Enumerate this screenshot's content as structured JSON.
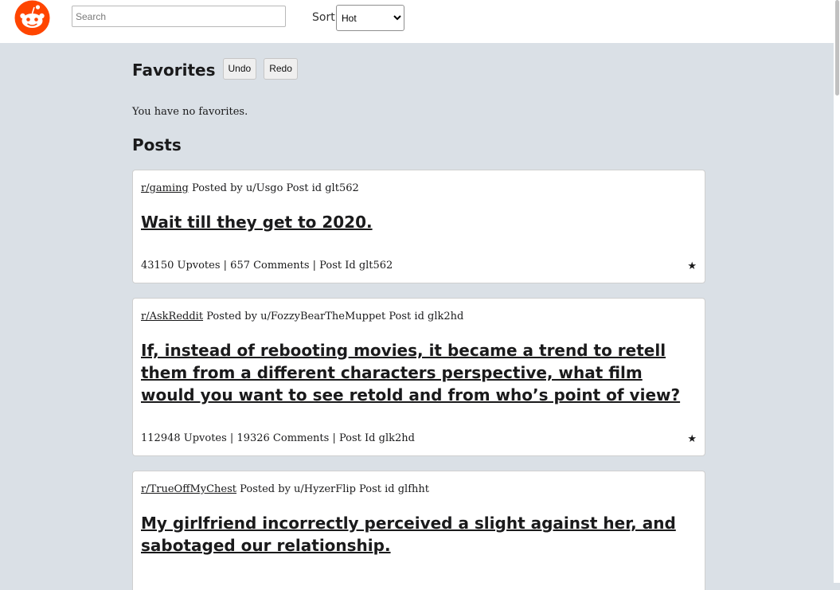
{
  "header": {
    "search_placeholder": "Search",
    "sort_label": "Sort",
    "sort_value": "Hot",
    "brand_color": "#ff4500"
  },
  "favorites": {
    "title": "Favorites",
    "undo_label": "Undo",
    "redo_label": "Redo",
    "empty_text": "You have no favorites."
  },
  "posts_title": "Posts",
  "posts": [
    {
      "subreddit": "r/gaming",
      "posted_by": "Posted by u/Usgo Post id glt562",
      "title": "Wait till they get to 2020.",
      "footer": "43150 Upvotes | 657 Comments | Post Id glt562",
      "star": "★"
    },
    {
      "subreddit": "r/AskReddit",
      "posted_by": "Posted by u/FozzyBearTheMuppet Post id glk2hd",
      "title": "If, instead of rebooting movies, it became a trend to retell them from a different characters perspective, what film would you want to see retold and from who’s point of view?",
      "footer": "112948 Upvotes | 19326 Comments | Post Id glk2hd",
      "star": "★"
    },
    {
      "subreddit": "r/TrueOffMyChest",
      "posted_by": "Posted by u/HyzerFlip Post id glfhht",
      "title": "My girlfriend incorrectly perceived a slight against her, and sabotaged our relationship.",
      "footer": "",
      "star": ""
    }
  ]
}
